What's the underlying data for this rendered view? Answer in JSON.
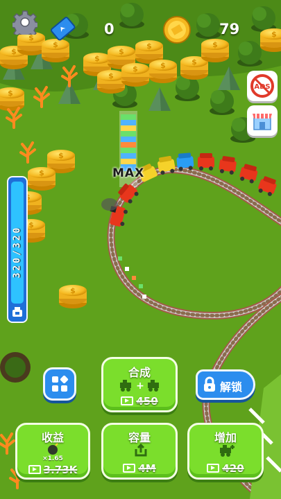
{
  "hud": {
    "settings_icon": "gear-icon",
    "ticket_icon": "ticket-icon",
    "ticket_count": "0",
    "coin_icon": "coin-icon",
    "coin_count": "79"
  },
  "side": {
    "ads_label": "ADS",
    "shop_icon": "shop-icon"
  },
  "capacity": {
    "text": "320/320",
    "level": 1.0
  },
  "train": {
    "max_label": "MAX"
  },
  "buttons": {
    "merge": {
      "label": "合成",
      "price": "450"
    },
    "unlock": {
      "label": "解锁"
    },
    "profit": {
      "label": "收益",
      "multiplier": "×1.65",
      "price": "3.73K"
    },
    "capacity": {
      "label": "容量",
      "price": "4M"
    },
    "add": {
      "label": "增加",
      "price": "420"
    }
  },
  "colors": {
    "grass": "#5fa21c",
    "button_green": "#7bde2c",
    "button_blue": "#2c8dee",
    "coin_gold": "#f5b820"
  }
}
